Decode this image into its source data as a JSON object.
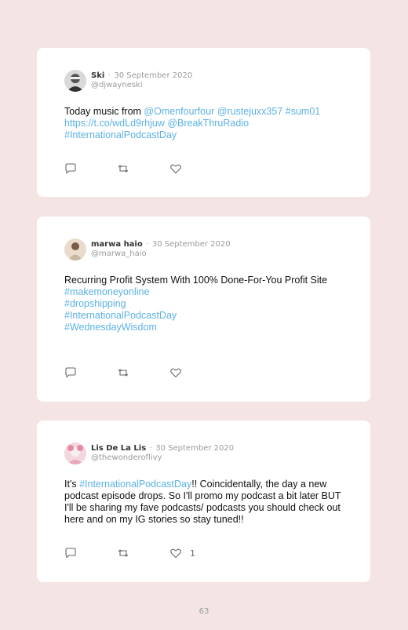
{
  "tweets": [
    {
      "name": "Ski",
      "separator": "·",
      "date": "30 September 2020",
      "handle": "@djwayneski",
      "text": [
        "Today music from ",
        "@Omenfourfour",
        " ",
        "@rustejuxx357",
        " ",
        "#sum01",
        "https://t.co/wdLd9rhjuw",
        " ",
        "@BreakThruRadio",
        "#InternationalPodcastDay"
      ],
      "likes": ""
    },
    {
      "name": "marwa haio",
      "separator": "·",
      "date": "30 September 2020",
      "handle": "@marwa_haio",
      "text": [
        "Recurring Profit System With 100% Done-For-You Profit Site",
        "#makemoneyonline",
        "#dropshipping",
        "#InternationalPodcastDay",
        "#WednesdayWisdom"
      ],
      "likes": ""
    },
    {
      "name": "Lis De La Lis",
      "separator": "·",
      "date": "30 September 2020",
      "handle": "@thewonderoflivy",
      "text": [
        "It's ",
        "#InternationalPodcastDay",
        "!! Coincidentally, the day a new podcast episode drops. So I'll promo my podcast a bit later BUT I'll be sharing my fave podcasts/ podcasts you should check out here and on my IG stories so stay tuned!!"
      ],
      "likes": "1"
    }
  ],
  "icons": {
    "reply": "reply-icon",
    "retweet": "retweet-icon",
    "like": "heart-icon"
  },
  "colors": {
    "background": "#f4e4e4",
    "card": "#ffffff",
    "link": "#5cb2e3"
  },
  "page_number": "63"
}
